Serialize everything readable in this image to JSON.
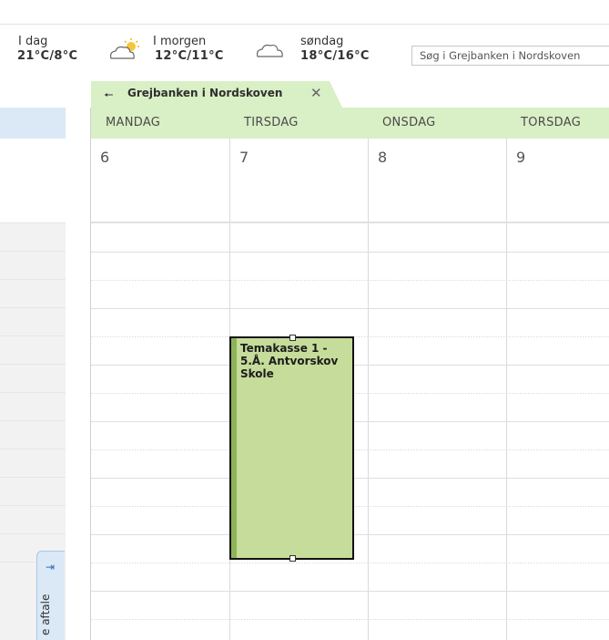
{
  "weather": [
    {
      "day": "I dag",
      "temp": "21°C/8°C"
    },
    {
      "day": "I morgen",
      "temp": "12°C/11°C",
      "icon": "partly-sunny-icon"
    },
    {
      "day": "søndag",
      "temp": "18°C/16°C",
      "icon": "cloud-icon"
    }
  ],
  "search": {
    "placeholder": "Søg i Grejbanken i Nordskoven"
  },
  "calendar_tab": {
    "title": "Grejbanken i Nordskoven",
    "back_icon": "back-arrow-icon",
    "close_icon": "close-icon"
  },
  "days": [
    {
      "name": "MANDAG",
      "date": "6"
    },
    {
      "name": "TIRSDAG",
      "date": "7"
    },
    {
      "name": "ONSDAG",
      "date": "8"
    },
    {
      "name": "TORSDAG",
      "date": "9"
    }
  ],
  "appointment": {
    "title": "Temakasse 1 - 5.Å. Antvorskov Skole",
    "day": "TIRSDAG"
  },
  "side_pane": {
    "label": "e aftale",
    "icon": "pin-arrow-icon"
  },
  "colors": {
    "header_green": "#d9efc5",
    "appointment_fill": "#c6dc9a",
    "nav_blue": "#dbe9f6"
  }
}
